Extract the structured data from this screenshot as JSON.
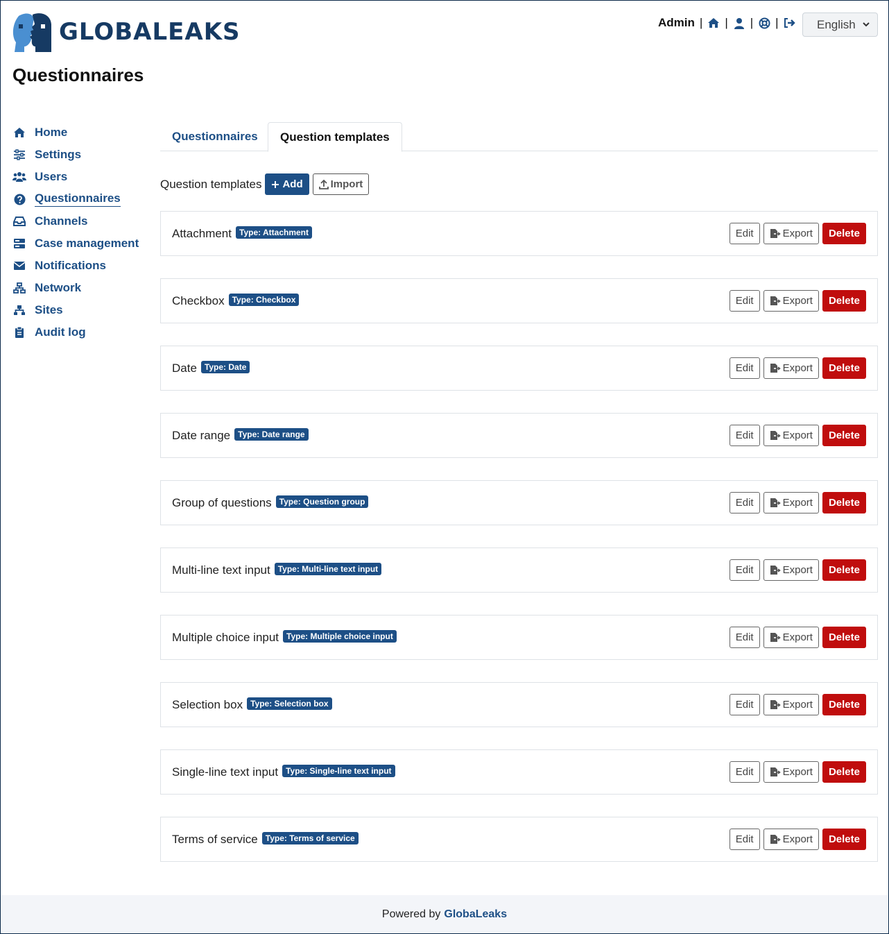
{
  "app": {
    "logo_text": "GLOBALEAKS",
    "page_title": "Questionnaires",
    "user_label": "Admin",
    "language": "English",
    "colors": {
      "brand": "#1d4f86",
      "danger": "#c00d0d",
      "logo": "#163a63",
      "logo_accent": "#4a8fd1"
    }
  },
  "topbar": {
    "icons": [
      "home-icon",
      "user-icon",
      "support-icon",
      "logout-icon"
    ]
  },
  "sidebar": {
    "items": [
      {
        "label": "Home",
        "icon": "home-icon"
      },
      {
        "label": "Settings",
        "icon": "sliders-icon"
      },
      {
        "label": "Users",
        "icon": "users-icon"
      },
      {
        "label": "Questionnaires",
        "icon": "question-circle-icon",
        "active": true
      },
      {
        "label": "Channels",
        "icon": "inbox-icon"
      },
      {
        "label": "Case management",
        "icon": "server-icon"
      },
      {
        "label": "Notifications",
        "icon": "envelope-icon"
      },
      {
        "label": "Network",
        "icon": "network-icon"
      },
      {
        "label": "Sites",
        "icon": "sitemap-icon"
      },
      {
        "label": "Audit log",
        "icon": "clipboard-icon"
      }
    ]
  },
  "tabs": [
    {
      "label": "Questionnaires",
      "active": false
    },
    {
      "label": "Question templates",
      "active": true
    }
  ],
  "section": {
    "label": "Question templates",
    "add_label": "Add",
    "import_label": "Import"
  },
  "templates": [
    {
      "name": "Attachment",
      "badge": "Type: Attachment"
    },
    {
      "name": "Checkbox",
      "badge": "Type: Checkbox"
    },
    {
      "name": "Date",
      "badge": "Type: Date"
    },
    {
      "name": "Date range",
      "badge": "Type: Date range"
    },
    {
      "name": "Group of questions",
      "badge": "Type: Question group"
    },
    {
      "name": "Multi-line text input",
      "badge": "Type: Multi-line text input"
    },
    {
      "name": "Multiple choice input",
      "badge": "Type: Multiple choice input"
    },
    {
      "name": "Selection box",
      "badge": "Type: Selection box"
    },
    {
      "name": "Single-line text input",
      "badge": "Type: Single-line text input"
    },
    {
      "name": "Terms of service",
      "badge": "Type: Terms of service"
    }
  ],
  "card_actions": {
    "edit": "Edit",
    "export": "Export",
    "delete": "Delete"
  },
  "footer": {
    "prefix": "Powered by",
    "brand": "GlobaLeaks"
  }
}
